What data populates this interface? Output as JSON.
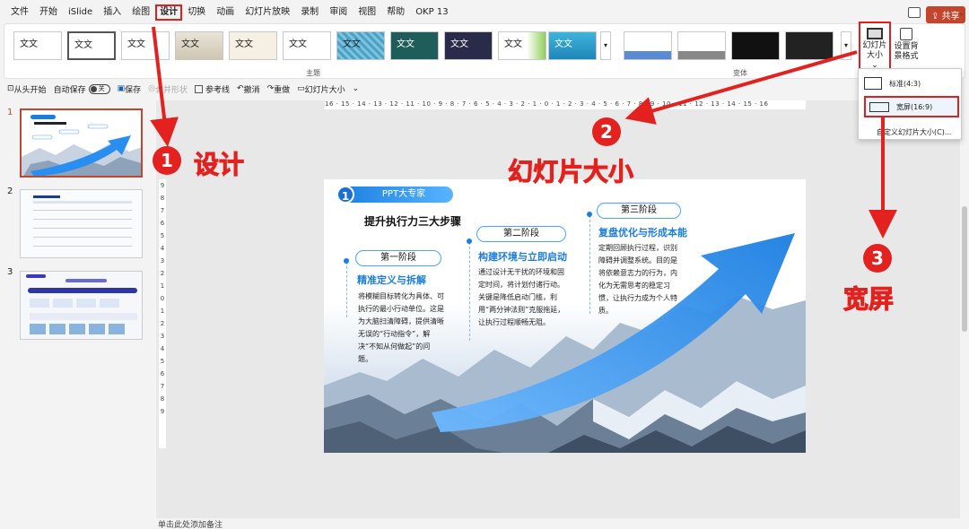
{
  "menu": {
    "items": [
      "文件",
      "开始",
      "iSlide",
      "插入",
      "绘图",
      "设计",
      "切换",
      "动画",
      "幻灯片放映",
      "录制",
      "审阅",
      "视图",
      "帮助",
      "OKP 13"
    ],
    "share_label": "共享",
    "collapse_label": "⌄"
  },
  "ribbon": {
    "theme_thumb_text": "文文",
    "theme_group_label": "主题",
    "variant_group_label": "变体",
    "slide_size_label": "幻灯片大小",
    "slide_size_caret": "⌄",
    "bg_format_label": "设置背景格式",
    "more_label": "▾"
  },
  "quick_access": {
    "from_start": "从头开始",
    "autosave": "自动保存",
    "autosave_state": "关",
    "save": "保存",
    "merge_shapes": "合并形状",
    "guides": "参考线",
    "undo": "撤消",
    "redo": "重做",
    "slide_size": "幻灯片大小",
    "more": "⌄"
  },
  "slides_pane": {
    "numbers": [
      "1",
      "2",
      "3"
    ]
  },
  "ruler": {
    "horizontal": "16 · 15 · 14 · 13 · 12 · 11 · 10 · 9 · 8 · 7 · 6 · 5 · 4 · 3 · 2 · 1 · 0 · 1 · 2 · 3 · 4 · 5 · 6 · 7 · 8 · 9 · 10 · 11 · 12 · 13 · 14 · 15 · 16",
    "vertical": [
      "9",
      "8",
      "7",
      "6",
      "5",
      "4",
      "3",
      "2",
      "1",
      "0",
      "1",
      "2",
      "3",
      "4",
      "5",
      "6",
      "7",
      "8",
      "9"
    ]
  },
  "slide": {
    "badge_number": "1",
    "badge_text": "PPT大专家",
    "title": "提升执行力三大步骤",
    "stages": [
      {
        "pill": "第一阶段",
        "heading": "精准定义与拆解",
        "body": "将模糊目标转化为具体、可执行的最小行动单位。这是为大脑扫清障碍，提供清晰无误的“行动指令”，解决“不知从何做起”的问题。"
      },
      {
        "pill": "第二阶段",
        "heading": "构建环境与立即启动",
        "body": "通过设计无干扰的环境和固定时间，将计划付诸行动。关键是降低启动门槛，利用“两分钟法则”克服拖延，让执行过程顺畅无阻。"
      },
      {
        "pill": "第三阶段",
        "heading": "复盘优化与形成本能",
        "body": "定期回顾执行过程，识别障碍并调整系统。目的是将依赖意志力的行为，内化为无需思考的稳定习惯，让执行力成为个人特质。"
      }
    ]
  },
  "notes": {
    "placeholder": "单击此处添加备注"
  },
  "size_dropdown": {
    "standard": "标准(4:3)",
    "widescreen": "宽屏(16:9)",
    "custom": "自定义幻灯片大小(C)..."
  },
  "annotations": {
    "steps": [
      {
        "number": "1",
        "text": "设计"
      },
      {
        "number": "2",
        "text": "幻灯片大小"
      },
      {
        "number": "3",
        "text": "宽屏"
      }
    ],
    "color": "#e3211e"
  },
  "colors": {
    "accent": "#1a7ee0",
    "share": "#c2452d",
    "highlight": "#e02020"
  }
}
